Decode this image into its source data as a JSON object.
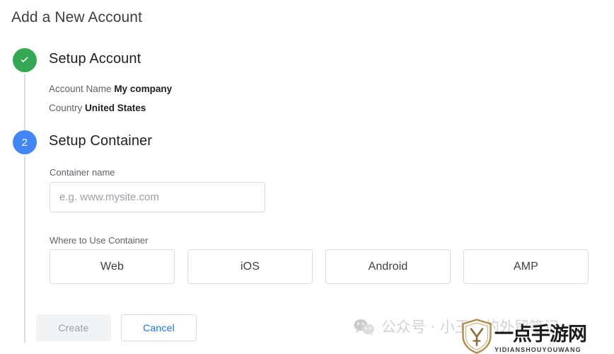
{
  "page": {
    "title": "Add a New Account"
  },
  "steps": [
    {
      "marker_icon": "check-icon",
      "marker_color": "#34A853",
      "title": "Setup Account",
      "state": "completed",
      "summary": [
        {
          "label": "Account Name",
          "value": "My company"
        },
        {
          "label": "Country",
          "value": "United States"
        }
      ]
    },
    {
      "marker_number": "2",
      "marker_color": "#4285F4",
      "title": "Setup Container",
      "state": "active"
    }
  ],
  "container_form": {
    "name_label": "Container name",
    "name_value": "",
    "name_placeholder": "e.g. www.mysite.com",
    "where_label": "Where to Use Container",
    "platforms": [
      {
        "label": "Web"
      },
      {
        "label": "iOS"
      },
      {
        "label": "Android"
      },
      {
        "label": "AMP"
      }
    ]
  },
  "actions": {
    "create_label": "Create",
    "create_disabled": true,
    "cancel_label": "Cancel",
    "cancel_color": "#1A73E8"
  },
  "watermarks": {
    "wechat_text": "公众号 · 小王子的外贸笔记",
    "site_name": "一点手游网",
    "site_pinyin": "YIDIANSHOUYOUWANG"
  }
}
